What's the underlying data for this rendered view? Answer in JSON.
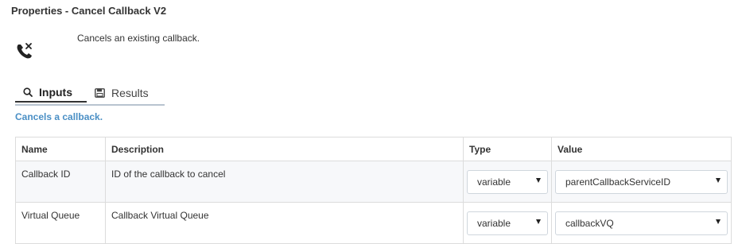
{
  "header": {
    "title": "Properties - Cancel Callback V2",
    "description": "Cancels an existing callback.",
    "icon": "phone-cancel-icon"
  },
  "tabs": [
    {
      "label": "Inputs",
      "icon": "search-icon",
      "active": true
    },
    {
      "label": "Results",
      "icon": "save-icon",
      "active": false
    }
  ],
  "subtitle": "Cancels a callback.",
  "table": {
    "headers": [
      "Name",
      "Description",
      "Type",
      "Value"
    ],
    "rows": [
      {
        "name": "Callback ID",
        "description": "ID of the callback to cancel",
        "type": "variable",
        "value": "parentCallbackServiceID"
      },
      {
        "name": "Virtual Queue",
        "description": "Callback Virtual Queue",
        "type": "variable",
        "value": "callbackVQ"
      }
    ]
  },
  "colors": {
    "accent": "#4a8fc5",
    "border": "#dcdcdc",
    "row_alt": "#f7f8fa"
  }
}
